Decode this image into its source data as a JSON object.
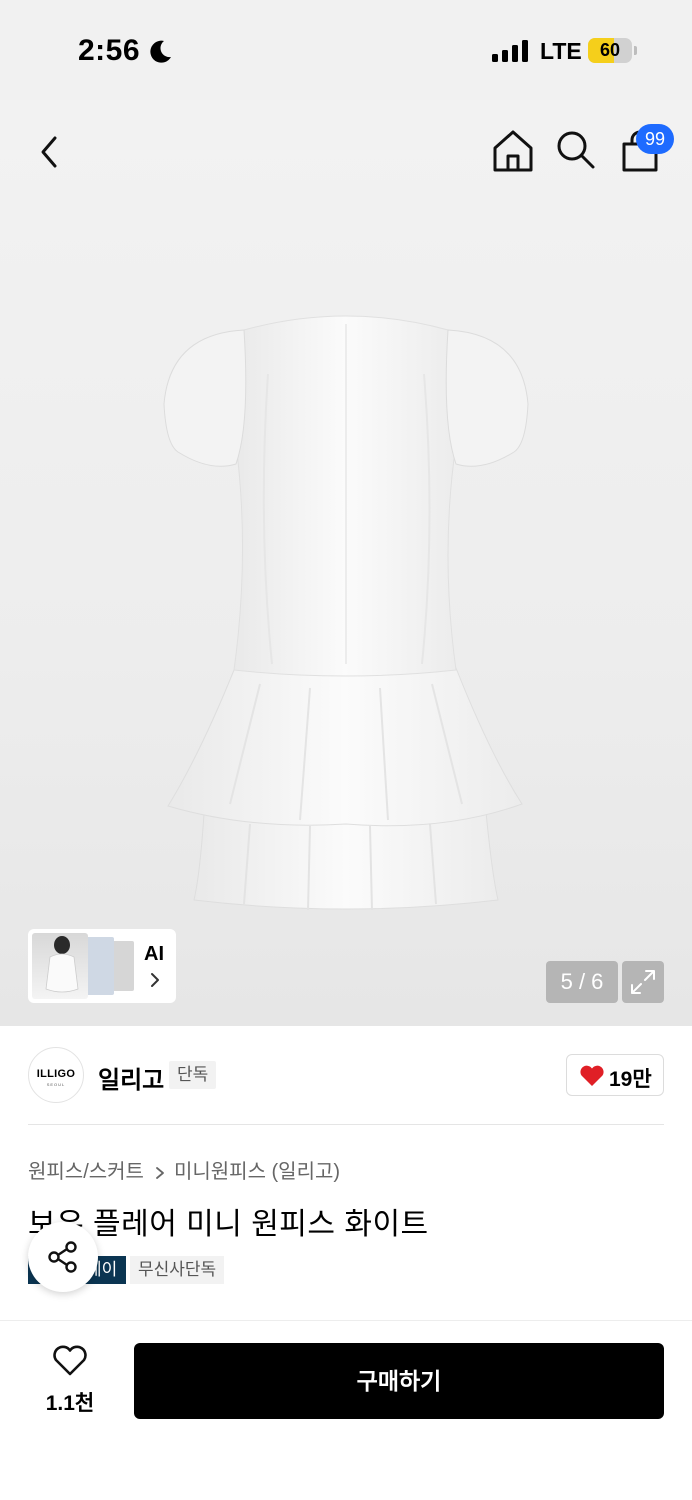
{
  "status_bar": {
    "time": "2:56",
    "network": "LTE",
    "battery_percent": 60,
    "battery_label": "60",
    "battery_color": "#f5cf1b"
  },
  "header": {
    "icons": [
      "back-icon",
      "home-icon",
      "search-icon",
      "shopping-bag-icon"
    ],
    "cart_badge": "99",
    "badge_color": "#1e6bff"
  },
  "gallery": {
    "ai_label": "AI",
    "page_indicator": "5 / 6"
  },
  "brand": {
    "logo_text": "ILLIGO",
    "logo_subtext": "SEOUL",
    "name": "일리고",
    "tag": "단독",
    "likes": "19만",
    "heart_color": "#e01f26"
  },
  "product": {
    "category": "원피스/스커트",
    "subcategory": "미니원피스 (일리고)",
    "title": "보우 플레어 미니 원피스 화이트",
    "badge_dark": "레이",
    "badge_dark_color": "#0b3552",
    "badge_light": "무신사단독"
  },
  "bottom_bar": {
    "wish_count": "1.1천",
    "buy_label": "구매하기"
  }
}
